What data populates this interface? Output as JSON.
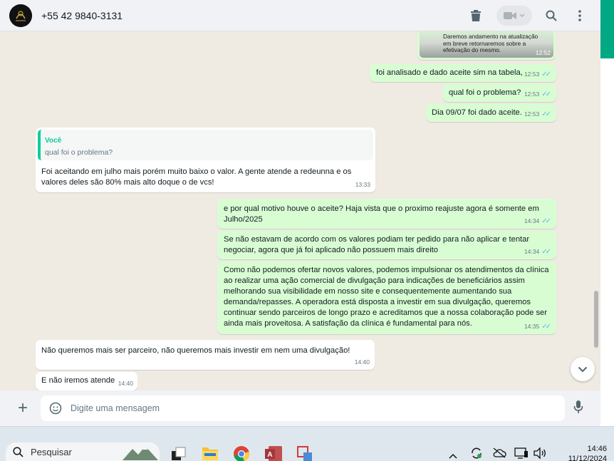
{
  "header": {
    "contact": "+55 42 9840-3131",
    "icons": [
      "trash-icon",
      "video-call-icon",
      "search-icon",
      "menu-dots-icon"
    ]
  },
  "messages": [
    {
      "dir": "out",
      "kind": "image-caption",
      "lines": [
        "Daremos andamento na atualização",
        "em breve retornaremos sobre a",
        "efetivação do mesmo."
      ],
      "time": "12:52"
    },
    {
      "dir": "out",
      "text": "foi analisado e dado aceite sim na tabela,",
      "time": "12:53",
      "read": true
    },
    {
      "dir": "out",
      "text": "qual foi o problema?",
      "time": "12:53",
      "read": true
    },
    {
      "dir": "out",
      "text": "Dia 09/07 foi dado aceite.",
      "time": "12:53",
      "read": true
    },
    {
      "dir": "in",
      "quote": {
        "author": "Você",
        "text": "qual foi o problema?"
      },
      "text": "Foi aceitando em julho mais porém muito baixo o valor. A gente atende a redeunna e os valores deles são 80% mais alto doque o de vcs!",
      "time": "13:33"
    },
    {
      "dir": "out",
      "text": "e por qual motivo houve o aceite? Haja vista que o proximo reajuste agora é somente em Julho/2025",
      "time": "14:34",
      "read": true
    },
    {
      "dir": "out",
      "text": "Se não estavam de acordo com os valores podiam ter pedido para não aplicar e tentar negociar, agora que já foi aplicado não possuem mais direito",
      "time": "14:34",
      "read": true
    },
    {
      "dir": "out",
      "text": "Como não podemos ofertar novos valores, podemos impulsionar os atendimentos da clínica ao realizar uma ação comercial de divulgação para indicações de beneficiários assim melhorando sua visibilidade em nosso site e consequentemente aumentando sua demanda/repasses. A operadora está disposta a investir em sua divulgação, queremos continuar sendo parceiros de longo prazo e acreditamos que a nossa colaboração pode ser ainda mais proveitosa. A satisfação da clínica é fundamental para nós.",
      "time": "14:35",
      "read": true
    },
    {
      "dir": "in",
      "text": "Não queremos mais ser parceiro, não queremos mais investir em nem uma divulgação!",
      "time": "14:40"
    },
    {
      "dir": "in",
      "text": "E não iremos atende",
      "time": "14:40"
    }
  ],
  "composer": {
    "placeholder": "Digite uma mensagem"
  },
  "taskbar": {
    "search_label": "Pesquisar",
    "time": "14:46",
    "date": "11/12/2024"
  },
  "colors": {
    "outgoing": "#d9fdd3",
    "incoming": "#ffffff",
    "accent": "#00a884",
    "read_ticks": "#53bdeb"
  }
}
